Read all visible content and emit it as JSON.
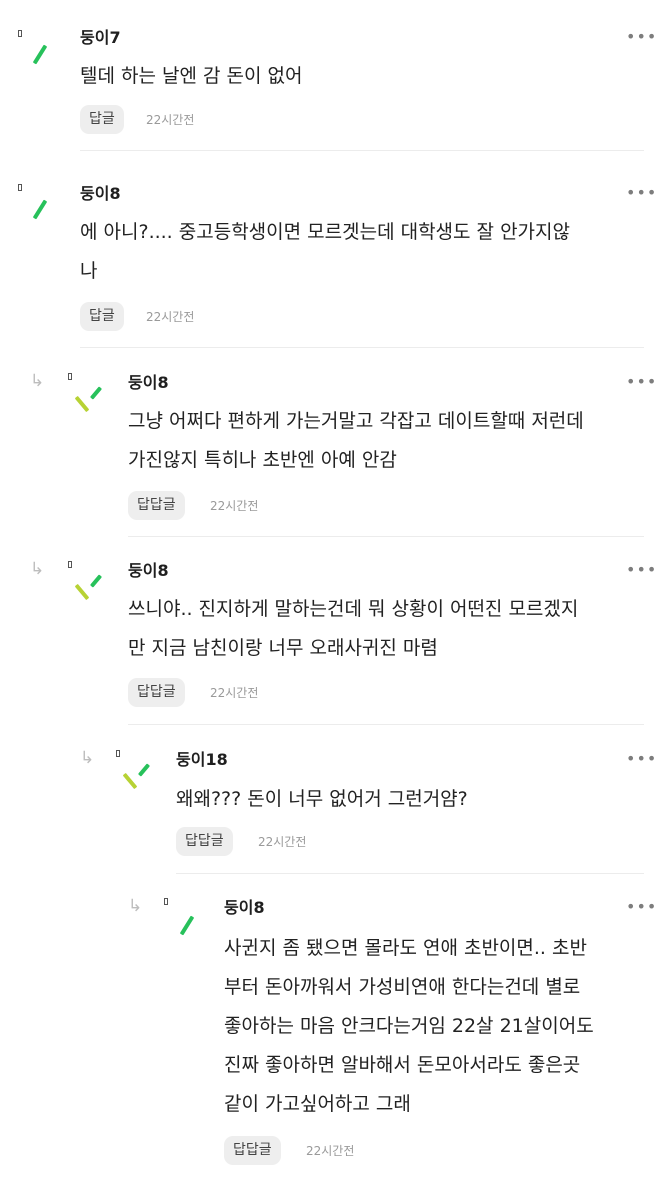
{
  "ui": {
    "more_glyph": "•••",
    "reply_arrow": "↳",
    "colors": {
      "green": "#27c15b",
      "lime": "#b7d234",
      "button_bg": "#eeeeee",
      "time": "#9a9a9a",
      "divider": "#ececec"
    },
    "icons": [
      "small-marker-icon",
      "avatar-stroke-icon",
      "reply-arrow-icon",
      "more-options-icon"
    ]
  },
  "comments": [
    {
      "author": "둥이7",
      "text": "텔데 하는 날엔 감 돈이 없어",
      "reply_label": "답글",
      "time": "22시간전",
      "depth": 0
    },
    {
      "author": "둥이8",
      "text": "에 아니?.... 중고등학생이면 모르겟는데 대학생도 잘 안가지않\n나",
      "reply_label": "답글",
      "time": "22시간전",
      "depth": 0
    },
    {
      "author": "둥이8",
      "text": "그냥 어쩌다 편하게 가는거말고 각잡고 데이트할때 저런데\n가진않지 특히나 초반엔 아예 안감",
      "reply_label": "답답글",
      "time": "22시간전",
      "depth": 1
    },
    {
      "author": "둥이8",
      "text": "쓰니야.. 진지하게 말하는건데 뭐 상황이 어떤진 모르겠지\n만 지금 남친이랑 너무 오래사귀진 마렴",
      "reply_label": "답답글",
      "time": "22시간전",
      "depth": 1
    },
    {
      "author": "둥이18",
      "text": "왜왜??? 돈이 너무 없어거 그런거얌?",
      "reply_label": "답답글",
      "time": "22시간전",
      "depth": 2
    },
    {
      "author": "둥이8",
      "text": "사귄지 좀 됐으면 몰라도 연애 초반이면.. 초반\n부터 돈아까워서 가성비연애 한다는건데 별로\n좋아하는 마음 안크다는거임 22살 21살이어도\n진짜 좋아하면 알바해서 돈모아서라도 좋은곳\n같이 가고싶어하고 그래",
      "reply_label": "답답글",
      "time": "22시간전",
      "depth": 3
    }
  ]
}
